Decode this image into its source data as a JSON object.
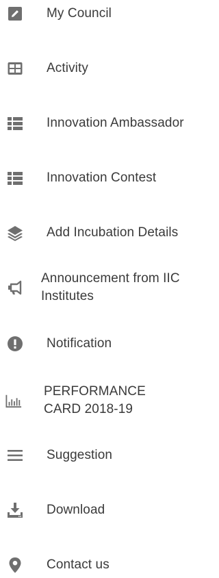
{
  "menu": {
    "icon_color": "#6f6f6f",
    "items": [
      {
        "icon": "edit-icon",
        "label": "My Council"
      },
      {
        "icon": "grid-icon",
        "label": "Activity"
      },
      {
        "icon": "list-icon",
        "label": "Innovation Ambassador"
      },
      {
        "icon": "list-icon",
        "label": "Innovation Contest"
      },
      {
        "icon": "layers-icon",
        "label": "Add Incubation Details"
      },
      {
        "icon": "megaphone-icon",
        "label": "Announcement from IIC Institutes"
      },
      {
        "icon": "alert-icon",
        "label": "Notification"
      },
      {
        "icon": "bar-chart-icon",
        "label": "PERFORMANCE CARD 2018-19"
      },
      {
        "icon": "hamburger-icon",
        "label": "Suggestion"
      },
      {
        "icon": "download-icon",
        "label": "Download"
      },
      {
        "icon": "location-pin-icon",
        "label": "Contact us"
      }
    ]
  }
}
